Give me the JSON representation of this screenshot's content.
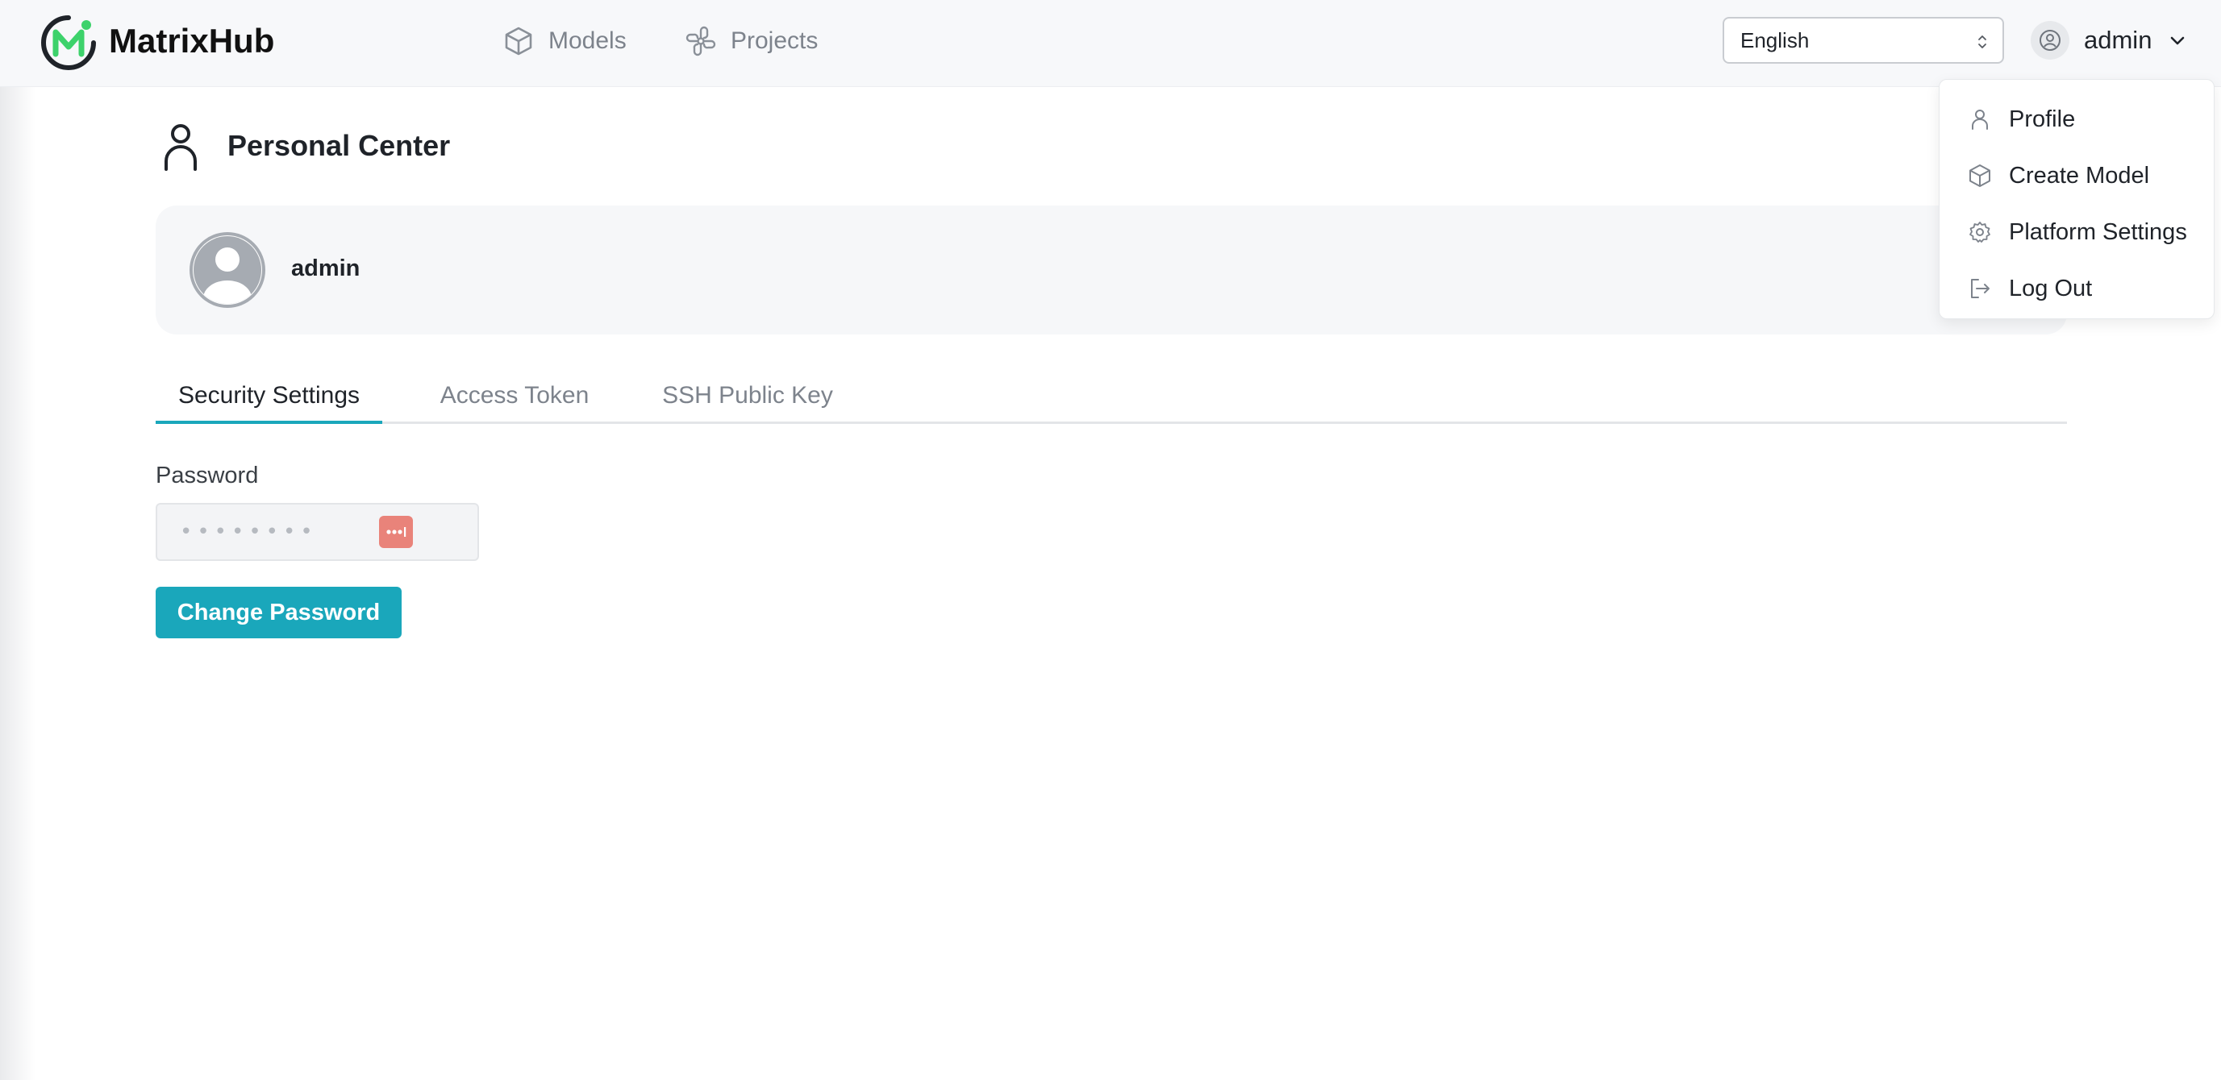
{
  "header": {
    "brand": "MatrixHub",
    "nav": [
      {
        "label": "Models",
        "icon": "cube-icon"
      },
      {
        "label": "Projects",
        "icon": "propeller-icon"
      }
    ],
    "language": {
      "selected": "English"
    },
    "user": {
      "name": "admin"
    }
  },
  "dropdown": {
    "items": [
      {
        "label": "Profile",
        "icon": "user-icon"
      },
      {
        "label": "Create Model",
        "icon": "cube-icon"
      },
      {
        "label": "Platform Settings",
        "icon": "gear-icon"
      },
      {
        "label": "Log Out",
        "icon": "logout-icon"
      }
    ]
  },
  "main": {
    "title": "Personal Center",
    "profile": {
      "name": "admin"
    },
    "tabs": [
      {
        "label": "Security Settings",
        "active": true
      },
      {
        "label": "Access Token",
        "active": false
      },
      {
        "label": "SSH Public Key",
        "active": false
      }
    ],
    "password": {
      "label": "Password",
      "value": "••••••••"
    },
    "change_password_label": "Change Password"
  },
  "colors": {
    "accent": "#1aa7bb",
    "logo_green": "#3dd26b",
    "password_manager": "#e9837a"
  }
}
